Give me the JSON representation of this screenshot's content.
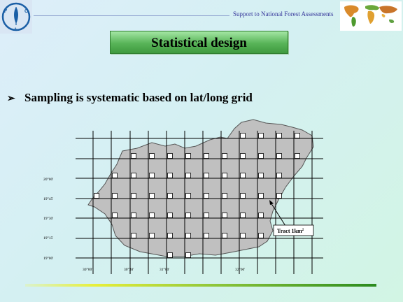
{
  "header": {
    "org_logo_icon": "fao-logo-icon",
    "logo_text": "F A O",
    "logo_motto": "FIAT PANIS",
    "tagline": "Support to National Forest Assessments",
    "map_icon": "world-map-icon"
  },
  "title": "Statistical design",
  "bullet": {
    "marker": "➢",
    "text": "Sampling is systematic based on lat/long grid"
  },
  "map": {
    "lat_labels": [
      "20°00'",
      "19°45'",
      "19°30'",
      "19°15'",
      "19°00'"
    ],
    "lon_labels": [
      "30°00'",
      "30°30'",
      "31°00'",
      "32°00'"
    ],
    "tract_label": "Tract 1km",
    "tract_sup": "2"
  },
  "colors": {
    "title_green": "#4caf50",
    "map_fill": "#c0c0c0",
    "grid_line": "#000000"
  }
}
